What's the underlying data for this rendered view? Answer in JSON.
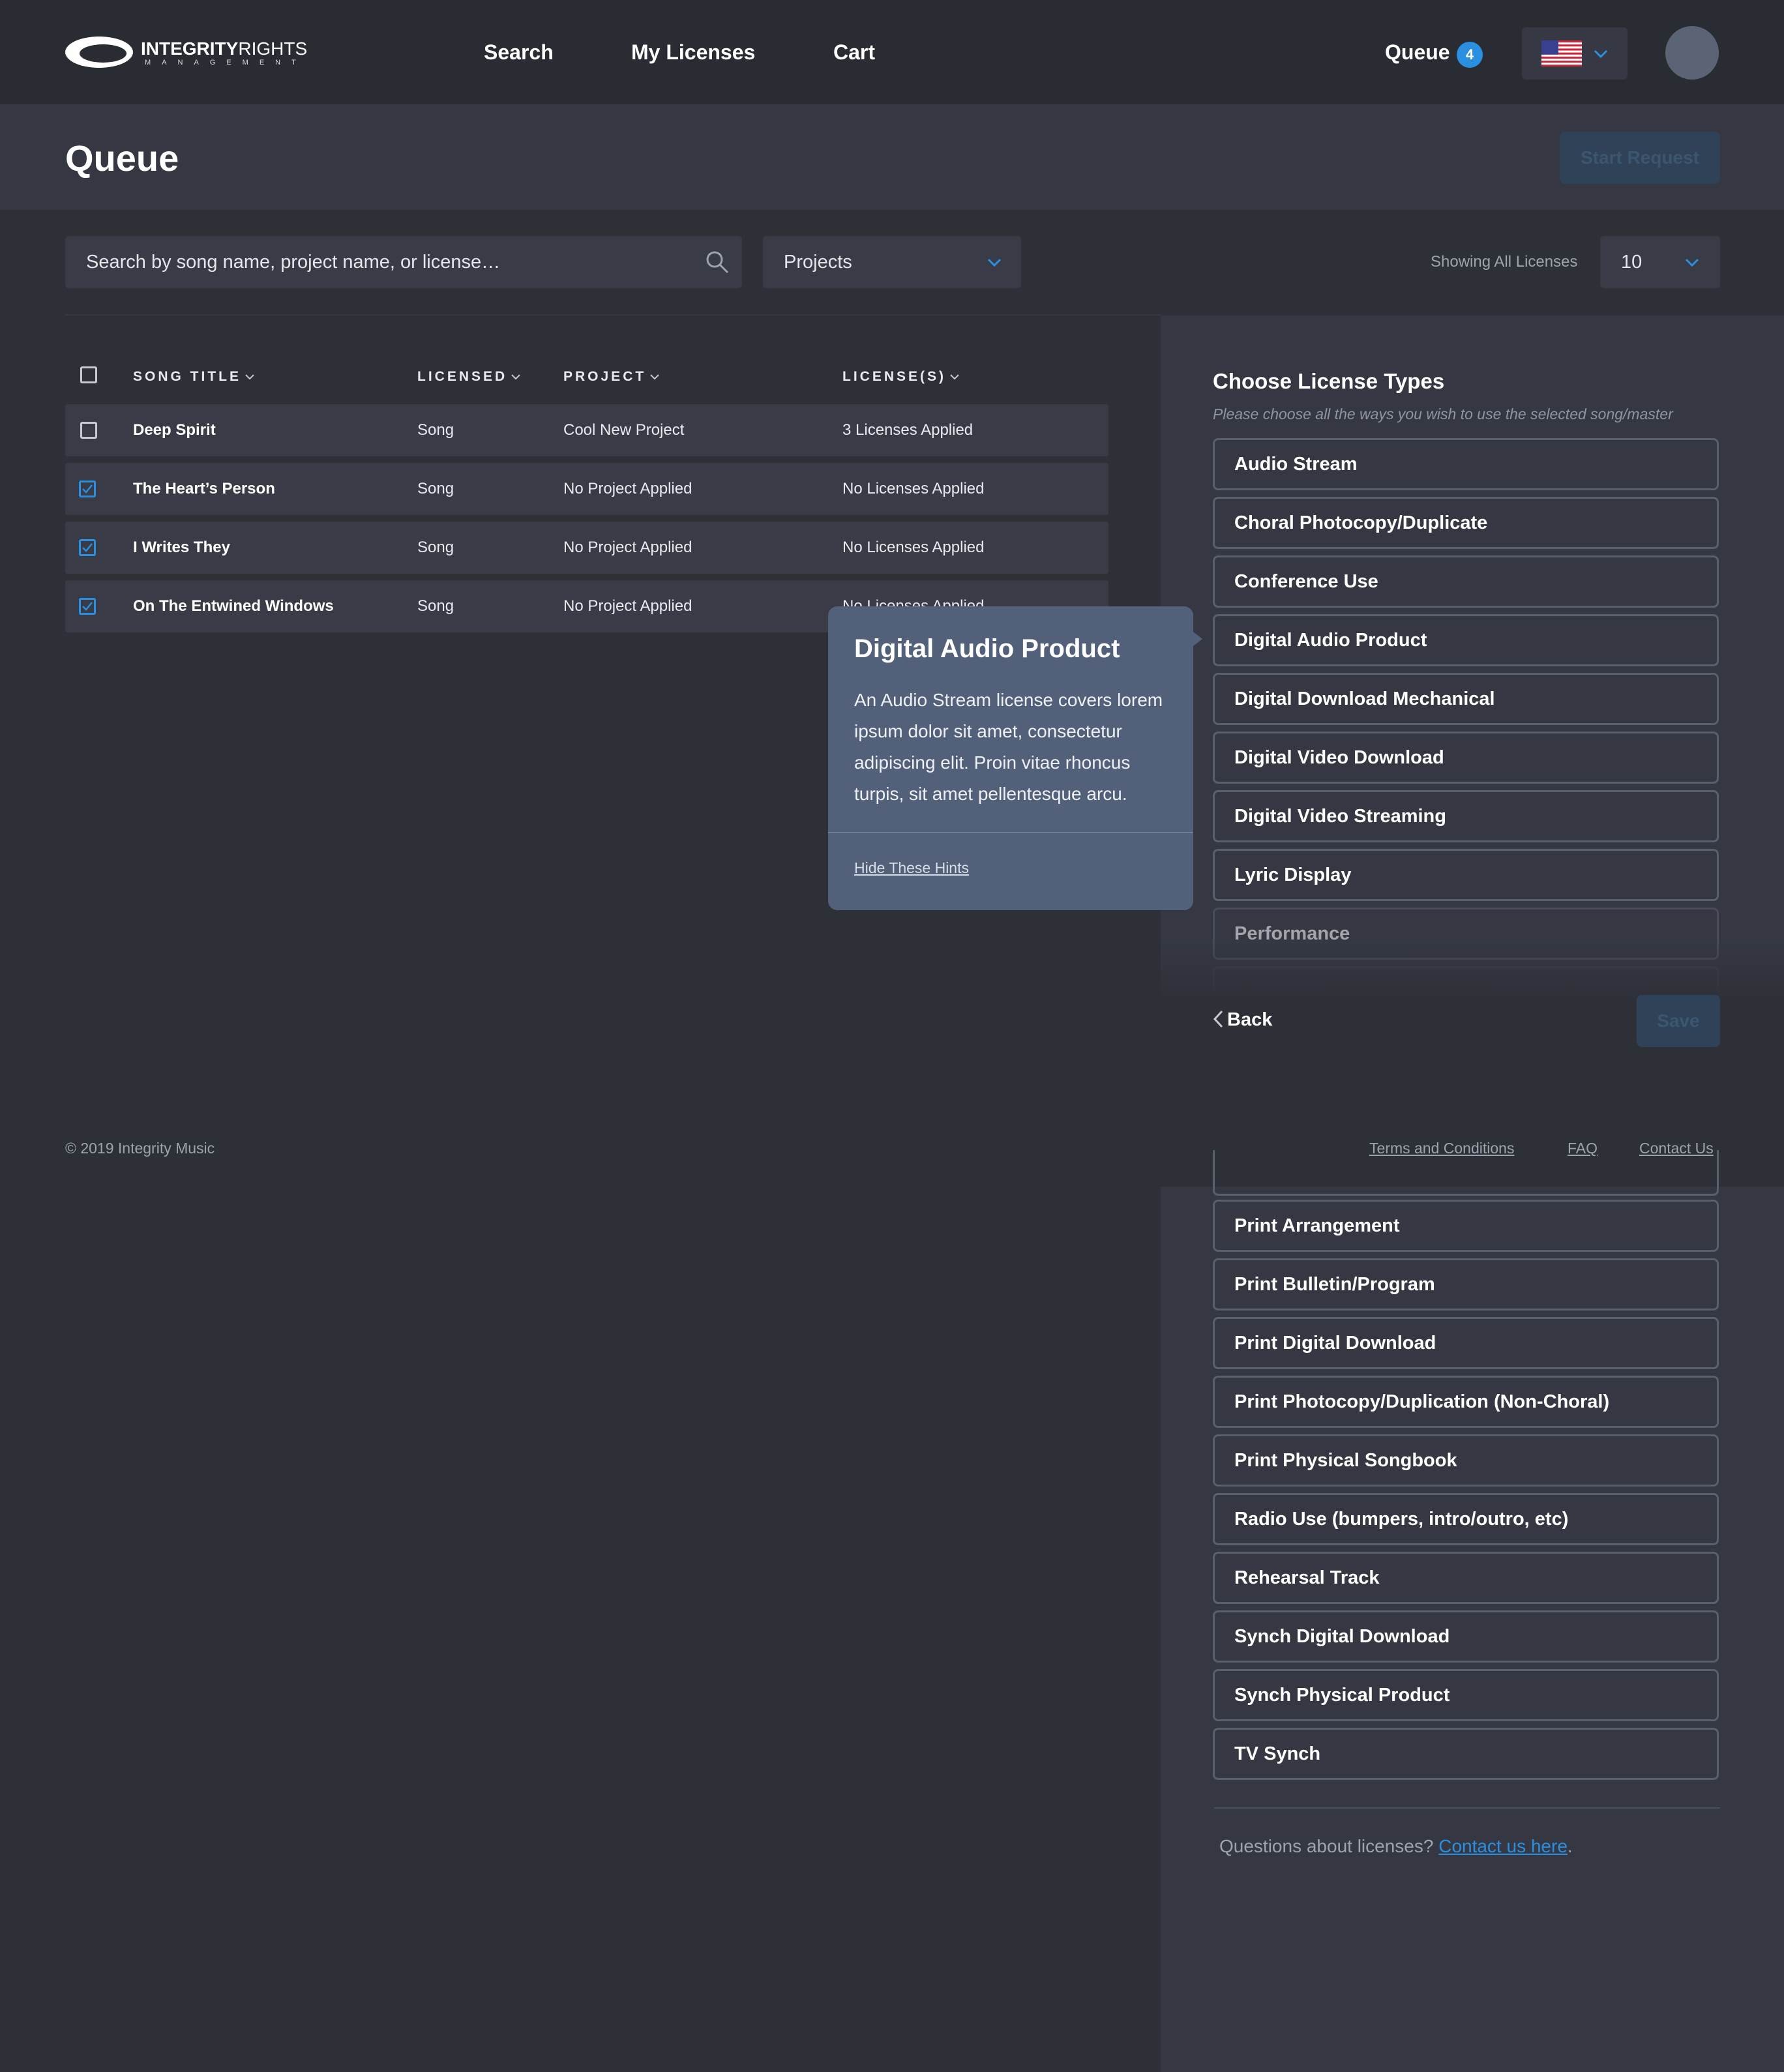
{
  "nav": {
    "logo_bold": "INTEGRITY",
    "logo_light": "RIGHTS",
    "logo_sub": "MANAGEMENT",
    "links": [
      "Search",
      "My Licenses",
      "Cart"
    ],
    "queue_label": "Queue",
    "queue_count": "4"
  },
  "header": {
    "title": "Queue",
    "start_button": "Start Request"
  },
  "filters": {
    "search_placeholder": "Search by song name, project name, or license…",
    "projects_label": "Projects",
    "showing_label": "Showing All Licenses",
    "per_page": "10"
  },
  "table": {
    "headers": [
      "SONG TITLE",
      "LICENSED",
      "PROJECT",
      "LICENSE(S)"
    ],
    "rows": [
      {
        "title": "Deep Spirit",
        "licensed": "Song",
        "project": "Cool New Project",
        "licenses": "3 Licenses Applied",
        "checked": false
      },
      {
        "title": "The Heart’s Person",
        "licensed": "Song",
        "project": "No Project Applied",
        "licenses": "No Licenses Applied",
        "checked": true
      },
      {
        "title": "I Writes They",
        "licensed": "Song",
        "project": "No Project Applied",
        "licenses": "No Licenses Applied",
        "checked": true
      },
      {
        "title": "On The Entwined Windows",
        "licensed": "Song",
        "project": "No Project Applied",
        "licenses": "No Licenses Applied",
        "checked": true
      }
    ]
  },
  "tooltip": {
    "title": "Digital Audio Product",
    "body": "An Audio Stream license covers lorem ipsum dolor sit amet, consectetur adipiscing elit. Proin vitae rhoncus turpis, sit amet pellentesque arcu.",
    "hide_link": "Hide These Hints"
  },
  "panel": {
    "title": "Choose License Types",
    "subtitle": "Please choose all the ways you wish to use the selected song/master",
    "top_options": [
      "Audio Stream",
      "Choral Photocopy/Duplicate",
      "Conference Use",
      "Digital Audio Product",
      "Digital Download Mechanical",
      "Digital Video Download",
      "Digital Video Streaming",
      "Lyric Display",
      "Performance"
    ],
    "bottom_options": [
      "Print Arrangement",
      "Print Bulletin/Program",
      "Print Digital Download",
      "Print Photocopy/Duplication (Non-Choral)",
      "Print Physical Songbook",
      "Radio Use (bumpers, intro/outro, etc)",
      "Rehearsal Track",
      "Synch Digital Download",
      "Synch Physical Product",
      "TV Synch"
    ],
    "back_label": "Back",
    "save_label": "Save",
    "questions_text": "Questions about licenses?",
    "contact_link": "Contact us here",
    "questions_end": "."
  },
  "footer": {
    "copyright": "© 2019 Integrity Music",
    "links": [
      "Terms and Conditions",
      "FAQ",
      "Contact Us"
    ]
  },
  "colors": {
    "accent": "#2b8fe0",
    "background": "#2e3038",
    "panel": "#353843",
    "tooltip": "#52607a"
  }
}
